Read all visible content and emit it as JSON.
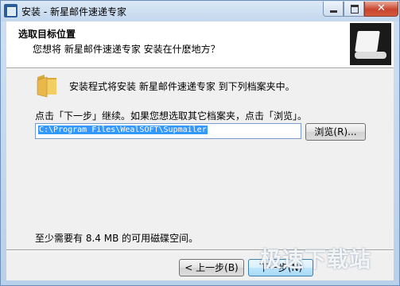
{
  "window": {
    "title": "安装 - 新星邮件速递专家",
    "controls": {
      "minimize": "minimize-icon",
      "maximize": "maximize-icon",
      "close": "close-icon"
    }
  },
  "header": {
    "title": "选取目标位置",
    "subtitle": "您想将 新星邮件速递专家 安装在什麽地方？"
  },
  "main": {
    "intro": "安装程式将安装 新星邮件速递专家 到下列档案夹中。",
    "instruction": "点击「下一步」继续。如果您想选取其它档案夹，点击「浏览」。",
    "path_value": "C:\\Program Files\\WealSOFT\\Supmailer",
    "browse_label": "浏览(R)...",
    "space_note": "至少需要有 8.4 MB 的可用磁碟空间。"
  },
  "footer": {
    "back_label": "< 上一步(B)",
    "next_label": "下一步(N)"
  },
  "watermark": {
    "text": "极速下载站"
  },
  "colors": {
    "selection": "#3399ff",
    "header_bg": "#ffffff",
    "body_bg": "#f0f0f0"
  }
}
